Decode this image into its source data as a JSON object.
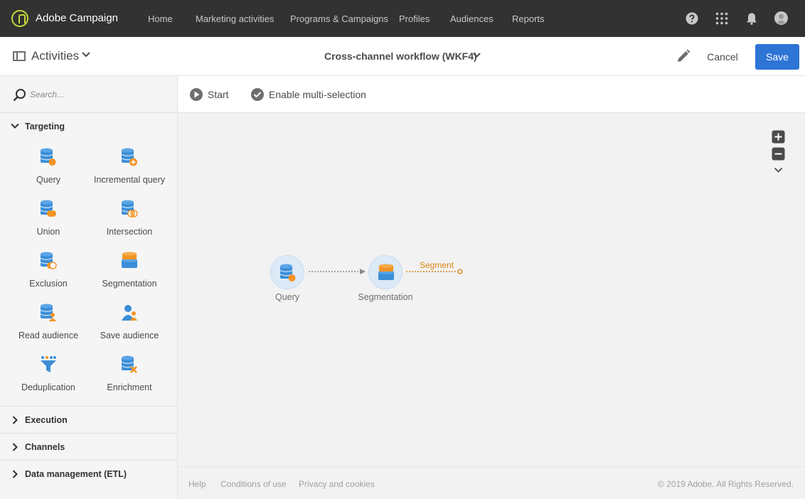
{
  "app": {
    "name": "Adobe Campaign"
  },
  "nav": {
    "items": [
      {
        "label": "Home"
      },
      {
        "label": "Marketing activities"
      },
      {
        "label": "Programs & Campaigns"
      },
      {
        "label": "Profiles"
      },
      {
        "label": "Audiences"
      },
      {
        "label": "Reports"
      }
    ]
  },
  "header": {
    "panel_title": "Activities",
    "workflow_title": "Cross-channel workflow (WKF4)",
    "cancel_label": "Cancel",
    "save_label": "Save"
  },
  "search": {
    "placeholder": "Search..."
  },
  "palette": {
    "targeting": {
      "label": "Targeting",
      "items": [
        {
          "label": "Query",
          "icon": "query-icon"
        },
        {
          "label": "Incremental query",
          "icon": "incremental-query-icon"
        },
        {
          "label": "Union",
          "icon": "union-icon"
        },
        {
          "label": "Intersection",
          "icon": "intersection-icon"
        },
        {
          "label": "Exclusion",
          "icon": "exclusion-icon"
        },
        {
          "label": "Segmentation",
          "icon": "segmentation-icon"
        },
        {
          "label": "Read audience",
          "icon": "read-audience-icon"
        },
        {
          "label": "Save audience",
          "icon": "save-audience-icon"
        },
        {
          "label": "Deduplication",
          "icon": "deduplication-icon"
        },
        {
          "label": "Enrichment",
          "icon": "enrichment-icon"
        }
      ]
    },
    "execution": {
      "label": "Execution"
    },
    "channels": {
      "label": "Channels"
    },
    "data_management": {
      "label": "Data management (ETL)"
    }
  },
  "toolbar": {
    "start_label": "Start",
    "multi_select_label": "Enable multi-selection"
  },
  "workflow": {
    "nodes": [
      {
        "label": "Query"
      },
      {
        "label": "Segmentation"
      }
    ],
    "transition_label": "Segment"
  },
  "footer": {
    "links": [
      {
        "label": "Help"
      },
      {
        "label": "Conditions of use"
      },
      {
        "label": "Privacy and cookies"
      }
    ],
    "copyright": "© 2019 Adobe. All Rights Reserved."
  },
  "colors": {
    "topbar": "#323232",
    "accent_blue": "#2d74d5",
    "icon_blue": "#3b8fd8",
    "icon_orange": "#f29423",
    "transition_orange": "#d98410"
  }
}
